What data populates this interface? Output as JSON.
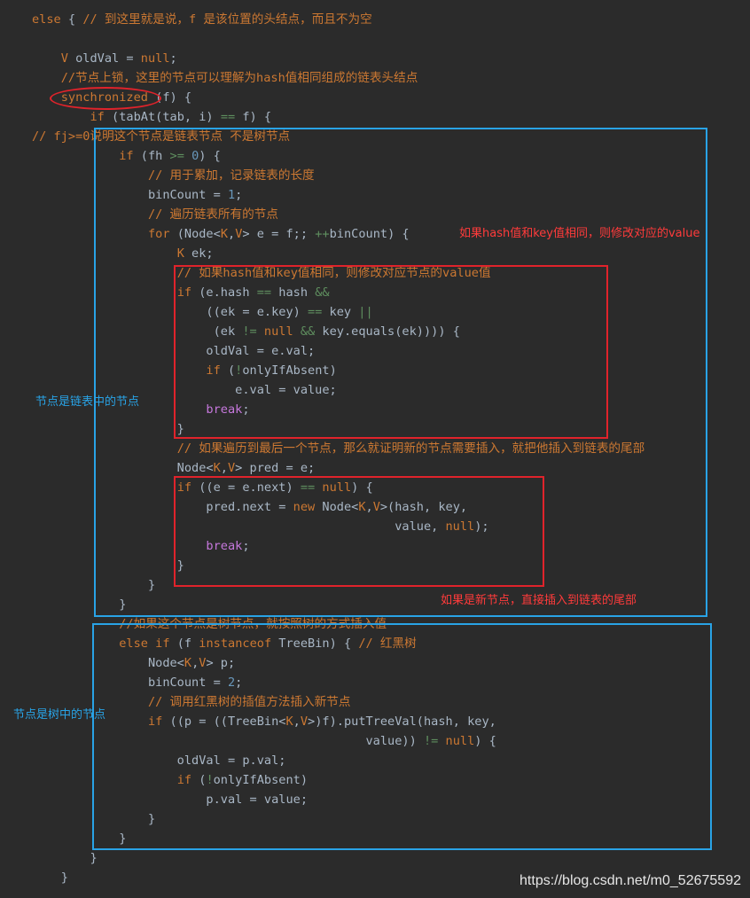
{
  "code_lines": [
    "else { // 到这里就是说，f 是该位置的头结点，而且不为空",
    "",
    "    V oldVal = null;",
    "    //节点上锁，这里的节点可以理解为hash值相同组成的链表头结点",
    "    synchronized (f) {",
    "        if (tabAt(tab, i) == f) {",
    "// fj>=0说明这个节点是链表节点 不是树节点",
    "            if (fh >= 0) {",
    "                // 用于累加，记录链表的长度",
    "                binCount = 1;",
    "                // 遍历链表所有的节点",
    "                for (Node<K,V> e = f;; ++binCount) {",
    "                    K ek;",
    "                    // 如果hash值和key值相同，则修改对应节点的value值",
    "                    if (e.hash == hash &&",
    "                        ((ek = e.key) == key ||",
    "                         (ek != null && key.equals(ek)))) {",
    "                        oldVal = e.val;",
    "                        if (!onlyIfAbsent)",
    "                            e.val = value;",
    "                        break;",
    "                    }",
    "                    // 如果遍历到最后一个节点，那么就证明新的节点需要插入，就把他插入到链表的尾部",
    "                    Node<K,V> pred = e;",
    "                    if ((e = e.next) == null) {",
    "                        pred.next = new Node<K,V>(hash, key,",
    "                                                  value, null);",
    "                        break;",
    "                    }",
    "                }",
    "            }",
    "            //如果这个节点是树节点，就按照树的方式插入值",
    "            else if (f instanceof TreeBin) { // 红黑树",
    "                Node<K,V> p;",
    "                binCount = 2;",
    "                // 调用红黑树的插值方法插入新节点",
    "                if ((p = ((TreeBin<K,V>)f).putTreeVal(hash, key,",
    "                                              value)) != null) {",
    "                    oldVal = p.val;",
    "                    if (!onlyIfAbsent)",
    "                        p.val = value;",
    "                }",
    "            }",
    "        }",
    "    }"
  ],
  "annotations": {
    "same_key_update": "如果hash值和key值相同，则修改对应的value",
    "list_node_label": "节点是链表中的节点",
    "new_node_insert": "如果是新节点，直接插入到链表的尾部",
    "tree_node_label": "节点是树中的节点"
  },
  "watermark": "https://blog.csdn.net/m0_52675592",
  "colors": {
    "background": "#2b2b2b",
    "keyword": "#cc7832",
    "identifier": "#a9b7c6",
    "number": "#6897bb",
    "blue_box": "#29a3e6",
    "red_box": "#e0232b",
    "red_text": "#ff3b3b",
    "blue_text": "#29a3e6"
  }
}
